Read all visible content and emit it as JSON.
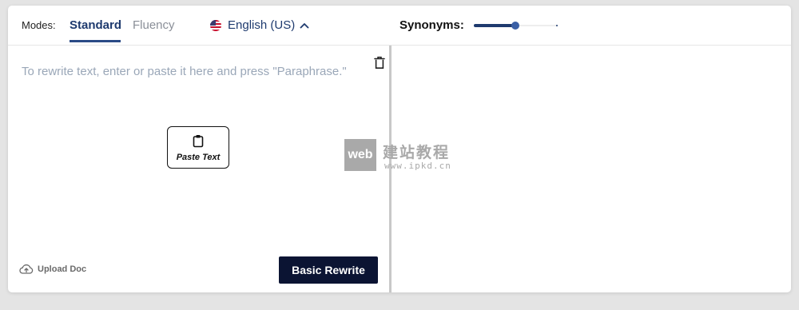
{
  "toolbar": {
    "modes_label": "Modes:",
    "modes": [
      {
        "label": "Standard",
        "active": true
      },
      {
        "label": "Fluency",
        "active": false
      }
    ],
    "language": {
      "label": "English (US)",
      "flag_icon": "us-flag-icon",
      "chevron_icon": "chevron-up-icon"
    },
    "synonyms": {
      "label": "Synonyms:",
      "level": 0.5,
      "steps": [
        0,
        0.25,
        0.5,
        0.75,
        1
      ]
    }
  },
  "editor": {
    "placeholder": "To rewrite text, enter or paste it here and press \"Paraphrase.\"",
    "value": "",
    "delete_icon": "trash-icon",
    "paste_button": {
      "label": "Paste Text",
      "icon": "clipboard-icon"
    },
    "upload": {
      "label": "Upload Doc",
      "icon": "cloud-upload-icon"
    },
    "rewrite_button": "Basic Rewrite"
  },
  "output": {
    "value": ""
  },
  "watermark": {
    "box": "web",
    "title": "建站教程",
    "url": "www.ipkd.cn"
  },
  "colors": {
    "accent": "#1e3a6e",
    "button_bg": "#0b1433",
    "page_bg": "#e4e4e4",
    "placeholder": "#9aa7b8"
  }
}
